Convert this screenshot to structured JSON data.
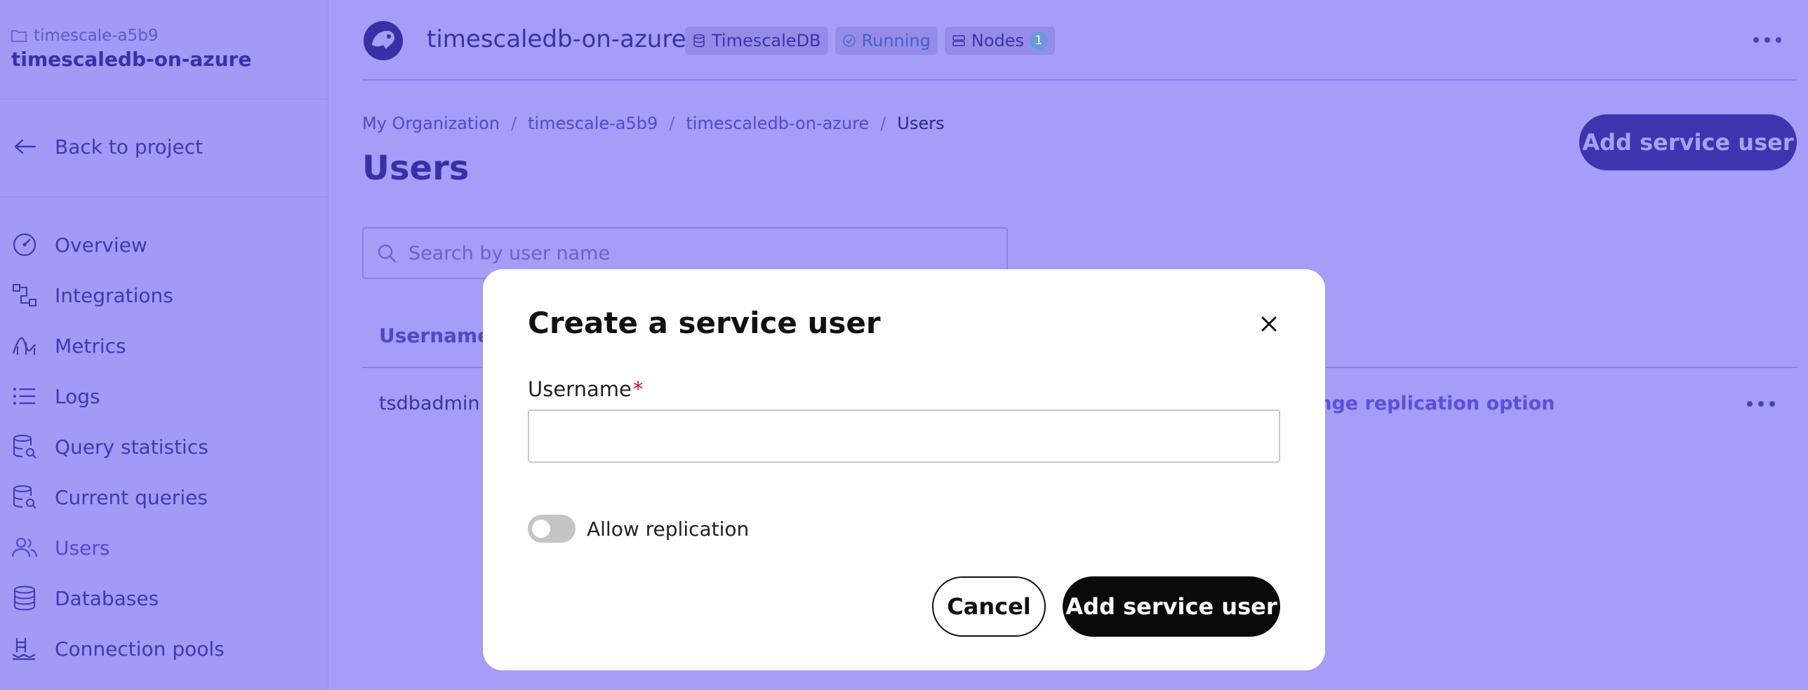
{
  "sidebar": {
    "project_name": "timescale-a5b9",
    "service_name": "timescaledb-on-azure",
    "back_label": "Back to project",
    "items": [
      {
        "label": "Overview",
        "icon": "gauge-icon"
      },
      {
        "label": "Integrations",
        "icon": "integrations-icon"
      },
      {
        "label": "Metrics",
        "icon": "metrics-icon"
      },
      {
        "label": "Logs",
        "icon": "list-icon"
      },
      {
        "label": "Query statistics",
        "icon": "database-search-icon"
      },
      {
        "label": "Current queries",
        "icon": "database-search-icon"
      },
      {
        "label": "Users",
        "icon": "users-icon"
      },
      {
        "label": "Databases",
        "icon": "database-icon"
      },
      {
        "label": "Connection pools",
        "icon": "pool-icon"
      }
    ],
    "active_item": "Users"
  },
  "header": {
    "title": "timescaledb-on-azure",
    "badges": {
      "type": "TimescaleDB",
      "status": "Running",
      "nodes_label": "Nodes",
      "nodes_count": "1"
    }
  },
  "breadcrumb": {
    "org": "My Organization",
    "project": "timescale-a5b9",
    "service": "timescaledb-on-azure",
    "current": "Users"
  },
  "page": {
    "title": "Users",
    "add_button": "Add service user",
    "search_placeholder": "Search by user name"
  },
  "table": {
    "column_username": "Username",
    "rows": [
      {
        "username": "tsdbadmin",
        "action": "ange replication option"
      }
    ]
  },
  "modal": {
    "title": "Create a service user",
    "username_label": "Username",
    "required_mark": "*",
    "username_value": "",
    "toggle_label": "Allow replication",
    "toggle_on": false,
    "cancel": "Cancel",
    "submit": "Add service user"
  },
  "colors": {
    "backdrop": "#a59df7",
    "accent": "#3f33b0",
    "primary_button": "#0a0a0a",
    "required": "#d0121b"
  }
}
